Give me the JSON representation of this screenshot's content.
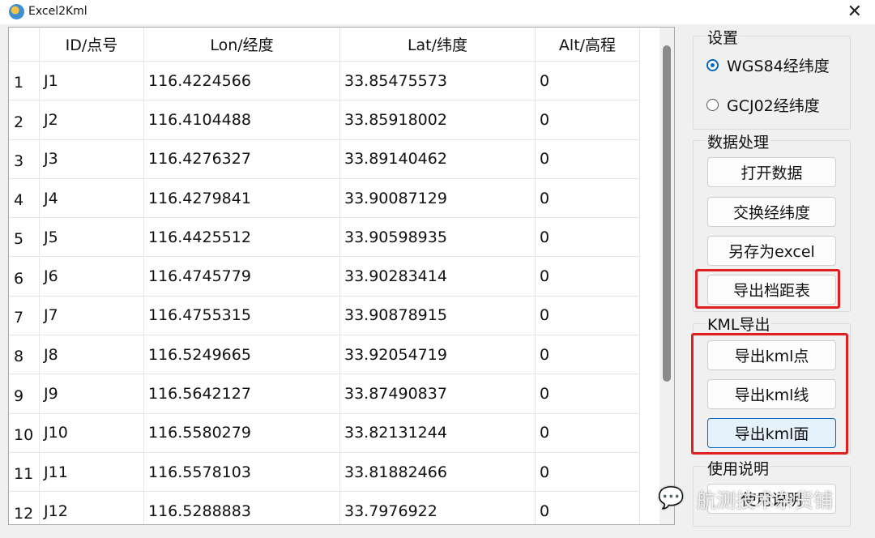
{
  "window": {
    "title": "Excel2Kml",
    "close": "✕"
  },
  "table": {
    "headers": [
      "ID/点号",
      "Lon/经度",
      "Lat/纬度",
      "Alt/高程"
    ],
    "rows": [
      {
        "n": "1",
        "id": "J1",
        "lon": "116.4224566",
        "lat": "33.85475573",
        "alt": "0"
      },
      {
        "n": "2",
        "id": "J2",
        "lon": "116.4104488",
        "lat": "33.85918002",
        "alt": "0"
      },
      {
        "n": "3",
        "id": "J3",
        "lon": "116.4276327",
        "lat": "33.89140462",
        "alt": "0"
      },
      {
        "n": "4",
        "id": "J4",
        "lon": "116.4279841",
        "lat": "33.90087129",
        "alt": "0"
      },
      {
        "n": "5",
        "id": "J5",
        "lon": "116.4425512",
        "lat": "33.90598935",
        "alt": "0"
      },
      {
        "n": "6",
        "id": "J6",
        "lon": "116.4745779",
        "lat": "33.90283414",
        "alt": "0"
      },
      {
        "n": "7",
        "id": "J7",
        "lon": "116.4755315",
        "lat": "33.90878915",
        "alt": "0"
      },
      {
        "n": "8",
        "id": "J8",
        "lon": "116.5249665",
        "lat": "33.92054719",
        "alt": "0"
      },
      {
        "n": "9",
        "id": "J9",
        "lon": "116.5642127",
        "lat": "33.87490837",
        "alt": "0"
      },
      {
        "n": "10",
        "id": "J10",
        "lon": "116.5580279",
        "lat": "33.82131244",
        "alt": "0"
      },
      {
        "n": "11",
        "id": "J11",
        "lon": "116.5578103",
        "lat": "33.81882466",
        "alt": "0"
      },
      {
        "n": "12",
        "id": "J12",
        "lon": "116.5288883",
        "lat": "33.7976922",
        "alt": "0"
      }
    ]
  },
  "settings": {
    "label": "设置",
    "options": [
      {
        "label": "WGS84经纬度",
        "selected": true
      },
      {
        "label": "GCJ02经纬度",
        "selected": false
      }
    ]
  },
  "data_processing": {
    "label": "数据处理",
    "buttons": [
      "打开数据",
      "交换经纬度",
      "另存为excel",
      "导出档距表"
    ]
  },
  "kml_export": {
    "label": "KML导出",
    "buttons": [
      "导出kml点",
      "导出kml线",
      "导出kml面"
    ]
  },
  "help": {
    "label": "使用说明",
    "button": "使用说明"
  },
  "watermark": "航测技术杂货铺",
  "colors": {
    "highlight": "#e02020",
    "accent": "#0067c0"
  }
}
